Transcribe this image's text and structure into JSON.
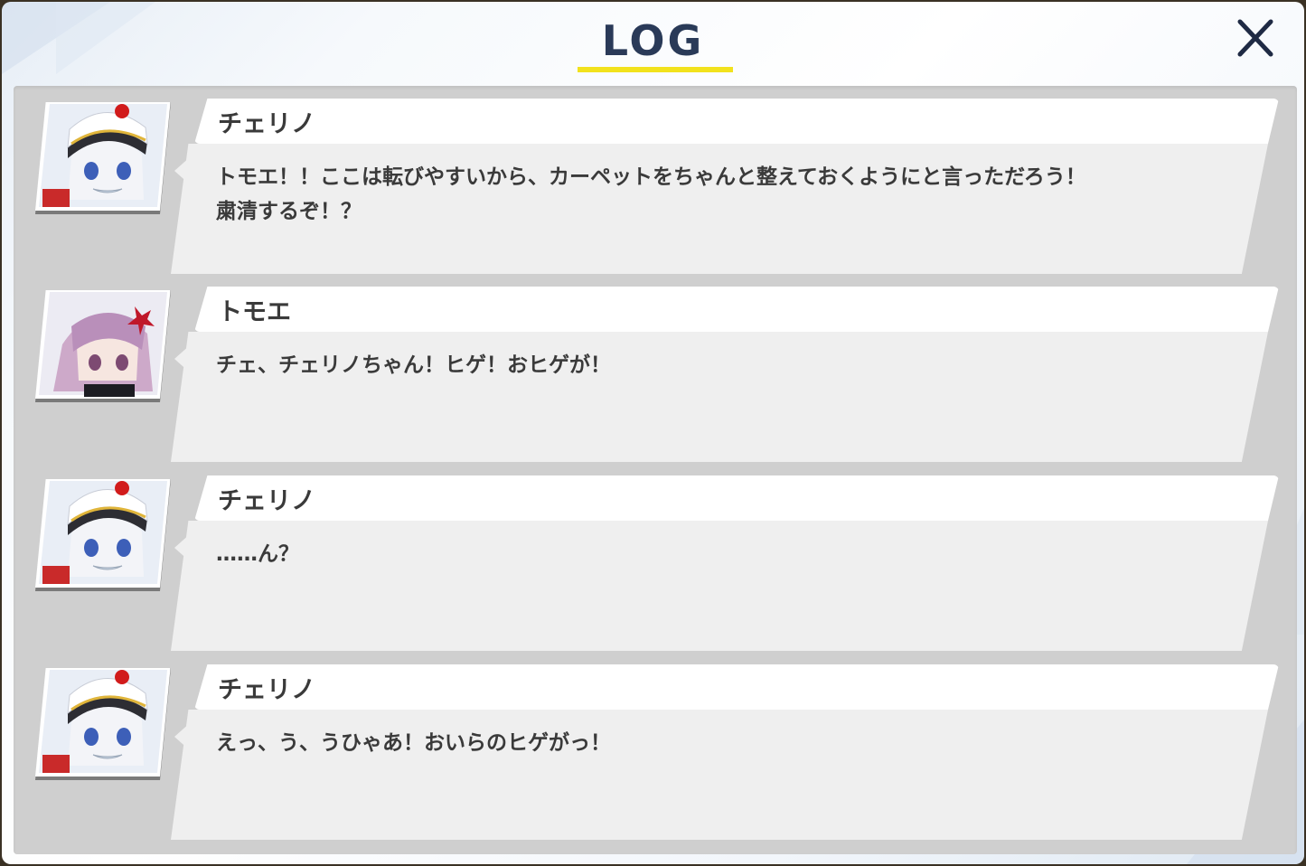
{
  "header": {
    "title": "LOG",
    "close_icon": "close-x-icon"
  },
  "colors": {
    "title": "#2a3a58",
    "underline": "#f2e21d",
    "panel": "#cfcfcf",
    "name_bar": "#ffffff",
    "bubble": "#efefef",
    "text": "#3a3a3a"
  },
  "entries": [
    {
      "speaker": "チェリノ",
      "avatar": "cherino-avatar",
      "message": "トモエ！！ここは転びやすいから、カーペットをちゃんと整えておくようにと言っただろう！\n粛清するぞ！？"
    },
    {
      "speaker": "トモエ",
      "avatar": "tomoe-avatar",
      "message": "チェ、チェリノちゃん！ヒゲ！おヒゲが！"
    },
    {
      "speaker": "チェリノ",
      "avatar": "cherino-avatar",
      "message": "……ん？"
    },
    {
      "speaker": "チェリノ",
      "avatar": "cherino-avatar",
      "message": "えっ、う、うひゃあ！おいらのヒゲがっ！"
    }
  ]
}
